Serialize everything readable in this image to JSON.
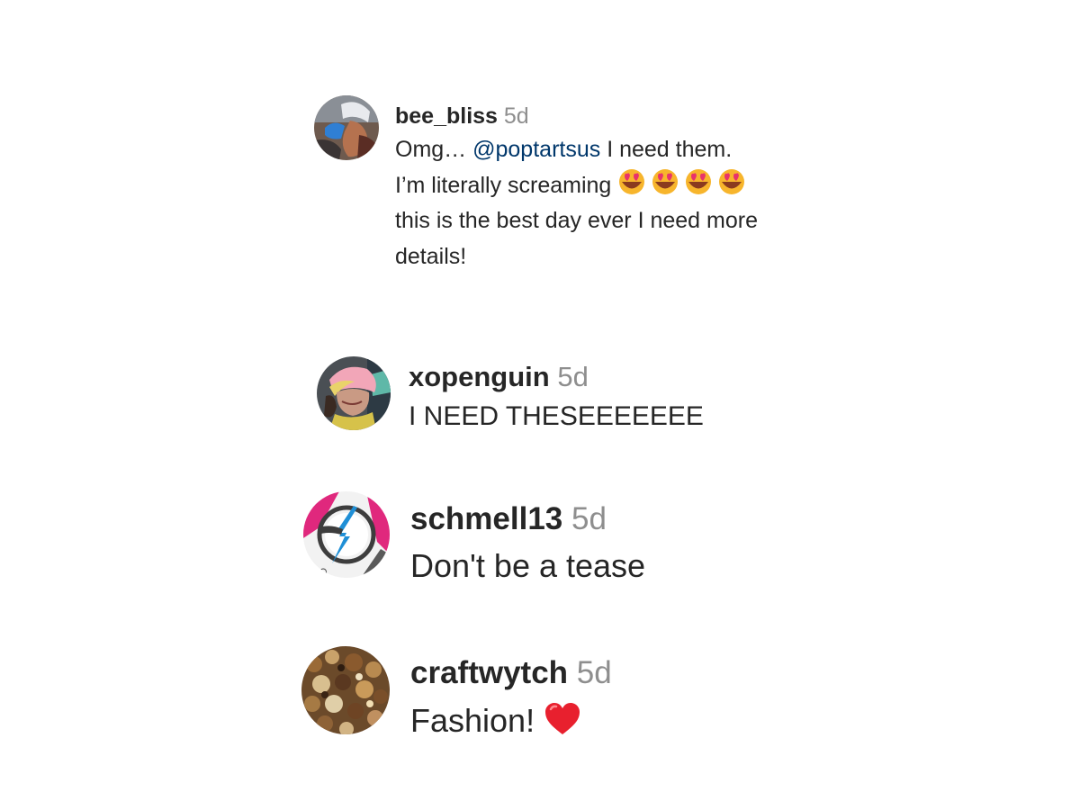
{
  "comments": [
    {
      "username": "bee_bliss",
      "time": "5d",
      "lines": {
        "l1_before": "Omg… ",
        "l1_mention": "@poptartsus",
        "l1_after": " I need them.",
        "l2": "I’m literally screaming ",
        "l3": "this is the best day ever I need more",
        "l4": "details!"
      },
      "emojis": [
        "heart-eyes-emoji",
        "heart-eyes-emoji",
        "heart-eyes-emoji",
        "heart-eyes-emoji"
      ]
    },
    {
      "username": "xopenguin",
      "time": "5d",
      "text": "I NEED THESEEEEEEE"
    },
    {
      "username": "schmell13",
      "time": "5d",
      "text": "Don't be a tease"
    },
    {
      "username": "craftwytch",
      "time": "5d",
      "text": "Fashion! ",
      "emojis": [
        "red-heart-emoji"
      ]
    }
  ],
  "colors": {
    "username": "#262626",
    "time": "#8e8e8e",
    "mention": "#00376b",
    "text": "#262626"
  }
}
